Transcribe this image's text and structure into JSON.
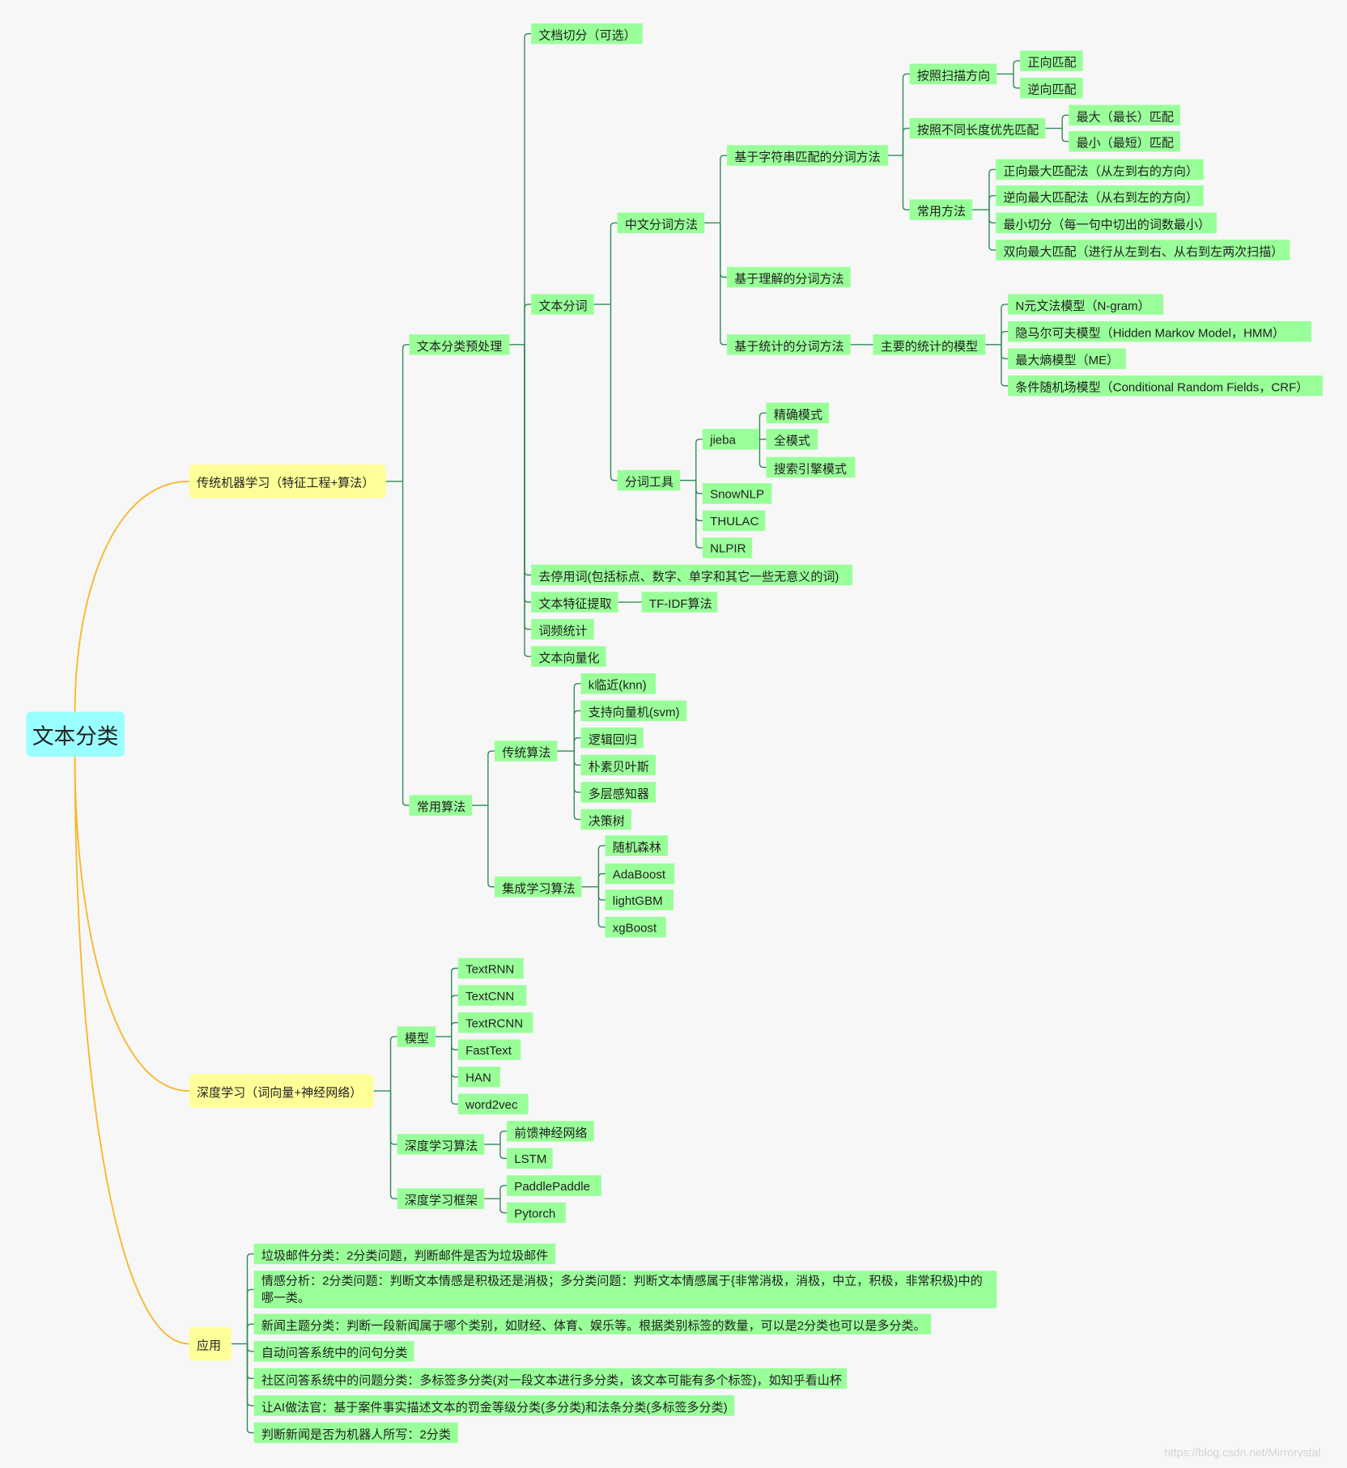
{
  "colors": {
    "root": "#99ffff",
    "branch": "#ffff99",
    "leaf": "#99ff99",
    "connector": "#2e8b57",
    "main_curve": "#f8b62b"
  },
  "tree": {
    "label": "文本分类",
    "children": [
      {
        "label": "传统机器学习（特征工程+算法）",
        "children": [
          {
            "label": "文本分类预处理",
            "children": [
              {
                "label": "文档切分（可选）"
              },
              {
                "label": "文本分词",
                "children": [
                  {
                    "label": "中文分词方法",
                    "children": [
                      {
                        "label": "基于字符串匹配的分词方法",
                        "children": [
                          {
                            "label": "按照扫描方向",
                            "children": [
                              {
                                "label": "正向匹配"
                              },
                              {
                                "label": "逆向匹配"
                              }
                            ]
                          },
                          {
                            "label": "按照不同长度优先匹配",
                            "children": [
                              {
                                "label": "最大（最长）匹配"
                              },
                              {
                                "label": "最小（最短）匹配"
                              }
                            ]
                          },
                          {
                            "label": "常用方法",
                            "children": [
                              {
                                "label": "正向最大匹配法（从左到右的方向）"
                              },
                              {
                                "label": "逆向最大匹配法（从右到左的方向）"
                              },
                              {
                                "label": "最小切分（每一句中切出的词数最小）"
                              },
                              {
                                "label": "双向最大匹配（进行从左到右、从右到左两次扫描）"
                              }
                            ]
                          }
                        ]
                      },
                      {
                        "label": "基于理解的分词方法"
                      },
                      {
                        "label": "基于统计的分词方法",
                        "children": [
                          {
                            "label": "主要的统计的模型",
                            "children": [
                              {
                                "label": "N元文法模型（N-gram）"
                              },
                              {
                                "label": "隐马尔可夫模型（Hidden Markov Model，HMM）"
                              },
                              {
                                "label": "最大熵模型（ME）"
                              },
                              {
                                "label": "条件随机场模型（Conditional Random Fields，CRF）"
                              }
                            ]
                          }
                        ]
                      }
                    ]
                  },
                  {
                    "label": "分词工具",
                    "children": [
                      {
                        "label": "jieba",
                        "children": [
                          {
                            "label": "精确模式"
                          },
                          {
                            "label": "全模式"
                          },
                          {
                            "label": "搜索引擎模式"
                          }
                        ]
                      },
                      {
                        "label": "SnowNLP"
                      },
                      {
                        "label": "THULAC"
                      },
                      {
                        "label": "NLPIR"
                      }
                    ]
                  }
                ]
              },
              {
                "label": "去停用词(包括标点、数字、单字和其它一些无意义的词)"
              },
              {
                "label": "文本特征提取",
                "children": [
                  {
                    "label": "TF-IDF算法"
                  }
                ]
              },
              {
                "label": "词频统计"
              },
              {
                "label": "文本向量化"
              }
            ]
          },
          {
            "label": "常用算法",
            "children": [
              {
                "label": "传统算法",
                "children": [
                  {
                    "label": "k临近(knn)"
                  },
                  {
                    "label": "支持向量机(svm)"
                  },
                  {
                    "label": "逻辑回归"
                  },
                  {
                    "label": "朴素贝叶斯"
                  },
                  {
                    "label": "多层感知器"
                  },
                  {
                    "label": "决策树"
                  }
                ]
              },
              {
                "label": "集成学习算法",
                "children": [
                  {
                    "label": "随机森林"
                  },
                  {
                    "label": "AdaBoost"
                  },
                  {
                    "label": "lightGBM"
                  },
                  {
                    "label": "xgBoost"
                  }
                ]
              }
            ]
          }
        ]
      },
      {
        "label": "深度学习（词向量+神经网络）",
        "children": [
          {
            "label": "模型",
            "children": [
              {
                "label": "TextRNN"
              },
              {
                "label": "TextCNN"
              },
              {
                "label": "TextRCNN"
              },
              {
                "label": "FastText"
              },
              {
                "label": "HAN"
              },
              {
                "label": "word2vec"
              }
            ]
          },
          {
            "label": "深度学习算法",
            "children": [
              {
                "label": "前馈神经网络"
              },
              {
                "label": "LSTM"
              }
            ]
          },
          {
            "label": "深度学习框架",
            "children": [
              {
                "label": "PaddlePaddle"
              },
              {
                "label": "Pytorch"
              }
            ]
          }
        ]
      },
      {
        "label": "应用",
        "children": [
          {
            "label": "垃圾邮件分类：2分类问题，判断邮件是否为垃圾邮件"
          },
          {
            "label": "情感分析：2分类问题：判断文本情感是积极还是消极；多分类问题：判断文本情感属于{非常消极，消极，中立，积极，非常积极}中的哪一类。"
          },
          {
            "label": "新闻主题分类：判断一段新闻属于哪个类别，如财经、体育、娱乐等。根据类别标签的数量，可以是2分类也可以是多分类。"
          },
          {
            "label": "自动问答系统中的问句分类"
          },
          {
            "label": "社区问答系统中的问题分类：多标签多分类(对一段文本进行多分类，该文本可能有多个标签)，如知乎看山杯"
          },
          {
            "label": "让AI做法官：基于案件事实描述文本的罚金等级分类(多分类)和法条分类(多标签多分类)"
          },
          {
            "label": "判断新闻是否为机器人所写：2分类"
          }
        ]
      }
    ]
  },
  "watermark": "https://blog.csdn.net/Mirrorystal"
}
